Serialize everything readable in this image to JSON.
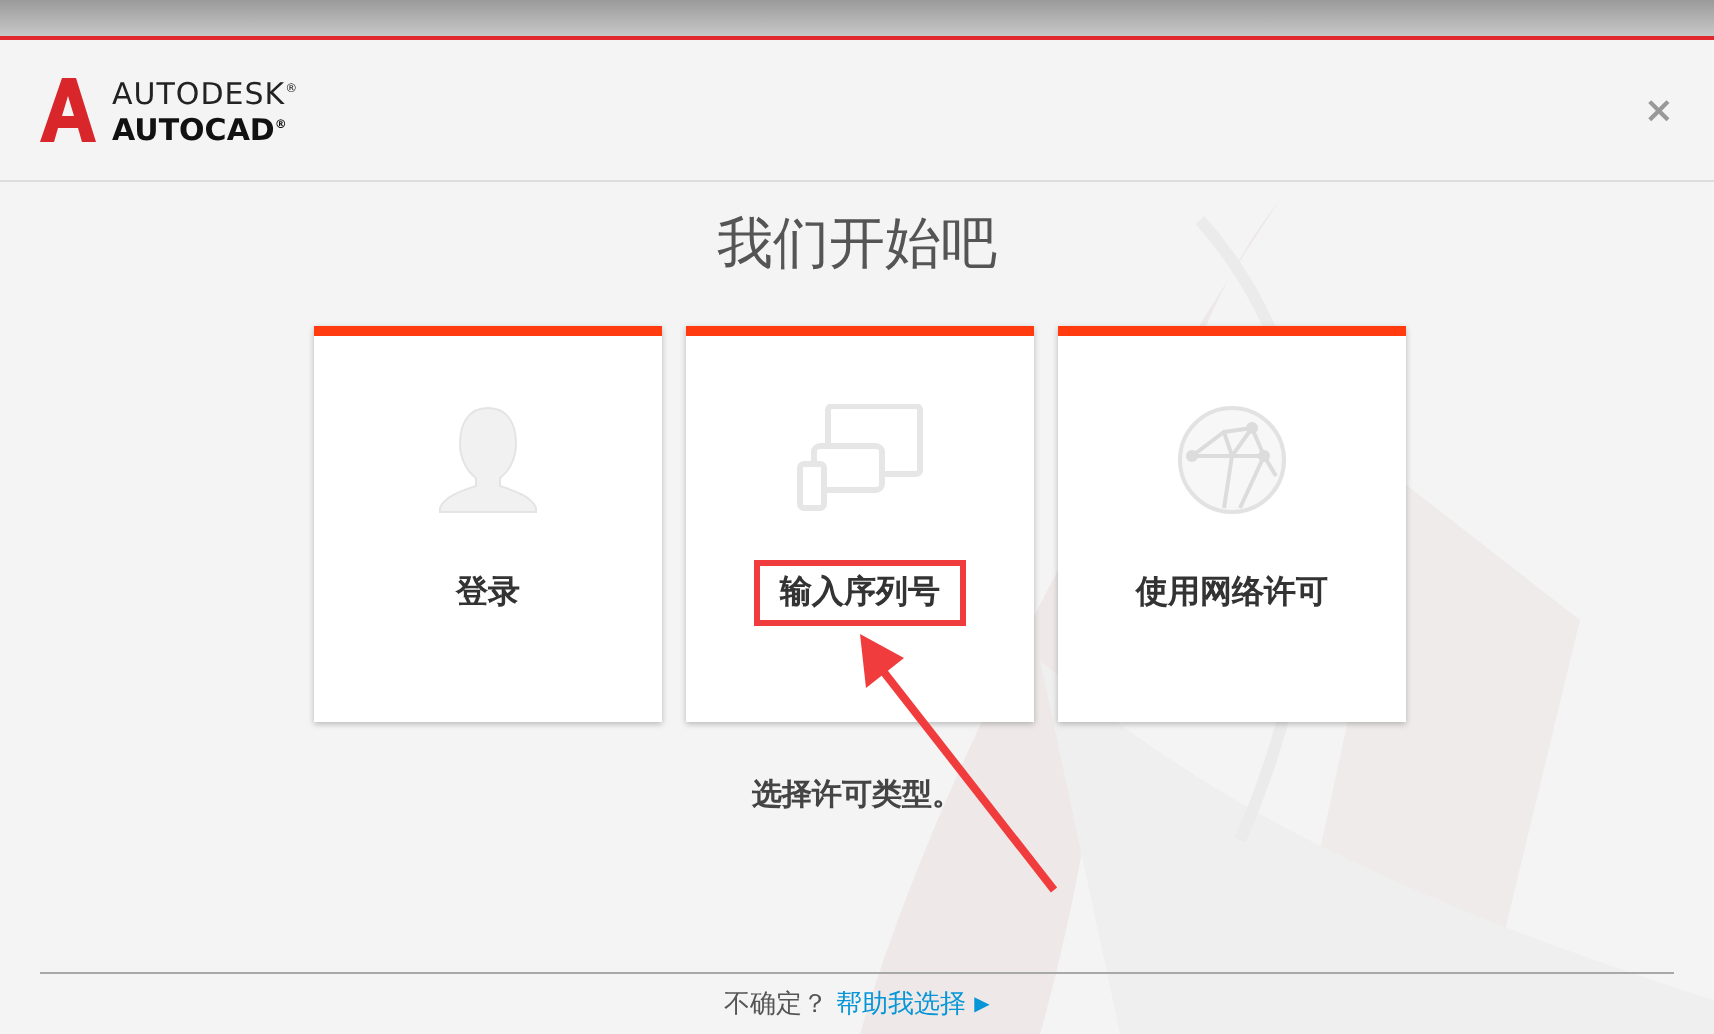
{
  "header": {
    "brand": "AUTODESK$^{®}$",
    "product": "AUTOCAD$^{®}$",
    "close": "×"
  },
  "title": "我们开始吧",
  "cards": [
    {
      "kind": "person",
      "label": "登录",
      "highlighted": false
    },
    {
      "kind": "devices",
      "label": "输入序列号",
      "highlighted": true
    },
    {
      "kind": "network",
      "label": "使用网络许可",
      "highlighted": false
    }
  ],
  "hint": "选择许可类型。",
  "footer": {
    "question": "不确定？",
    "link": "帮助我选择",
    "link_icon": "▶"
  }
}
